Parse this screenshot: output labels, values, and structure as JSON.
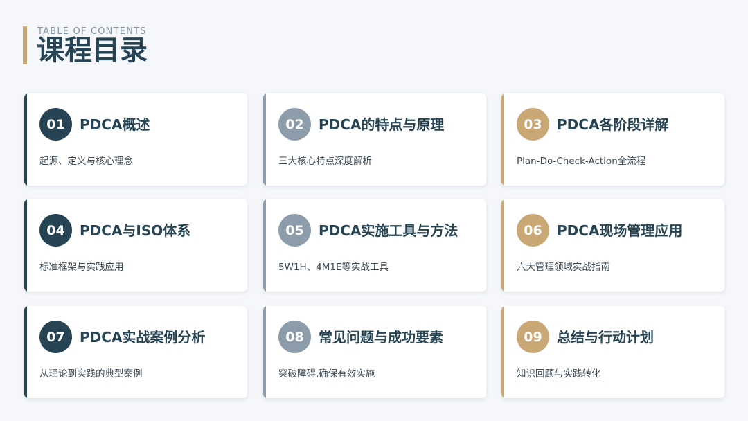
{
  "header": {
    "subtitle": "TABLE OF CONTENTS",
    "title": "课程目录"
  },
  "colors": {
    "accent_bar": "#c9a876",
    "dark": "#264454",
    "gray": "#8d9cab",
    "gold": "#c9a876"
  },
  "items": [
    {
      "num": "01",
      "title": "PDCA概述",
      "desc": "起源、定义与核心理念",
      "color": "#264454"
    },
    {
      "num": "02",
      "title": "PDCA的特点与原理",
      "desc": "三大核心特点深度解析",
      "color": "#8d9cab"
    },
    {
      "num": "03",
      "title": "PDCA各阶段详解",
      "desc": "Plan-Do-Check-Action全流程",
      "color": "#c9a876"
    },
    {
      "num": "04",
      "title": "PDCA与ISO体系",
      "desc": "标准框架与实践应用",
      "color": "#264454"
    },
    {
      "num": "05",
      "title": "PDCA实施工具与方法",
      "desc": "5W1H、4M1E等实战工具",
      "color": "#8d9cab"
    },
    {
      "num": "06",
      "title": "PDCA现场管理应用",
      "desc": "六大管理领域实战指南",
      "color": "#c9a876"
    },
    {
      "num": "07",
      "title": "PDCA实战案例分析",
      "desc": "从理论到实践的典型案例",
      "color": "#264454"
    },
    {
      "num": "08",
      "title": "常见问题与成功要素",
      "desc": "突破障碍,确保有效实施",
      "color": "#8d9cab"
    },
    {
      "num": "09",
      "title": "总结与行动计划",
      "desc": "知识回顾与实践转化",
      "color": "#c9a876"
    }
  ]
}
